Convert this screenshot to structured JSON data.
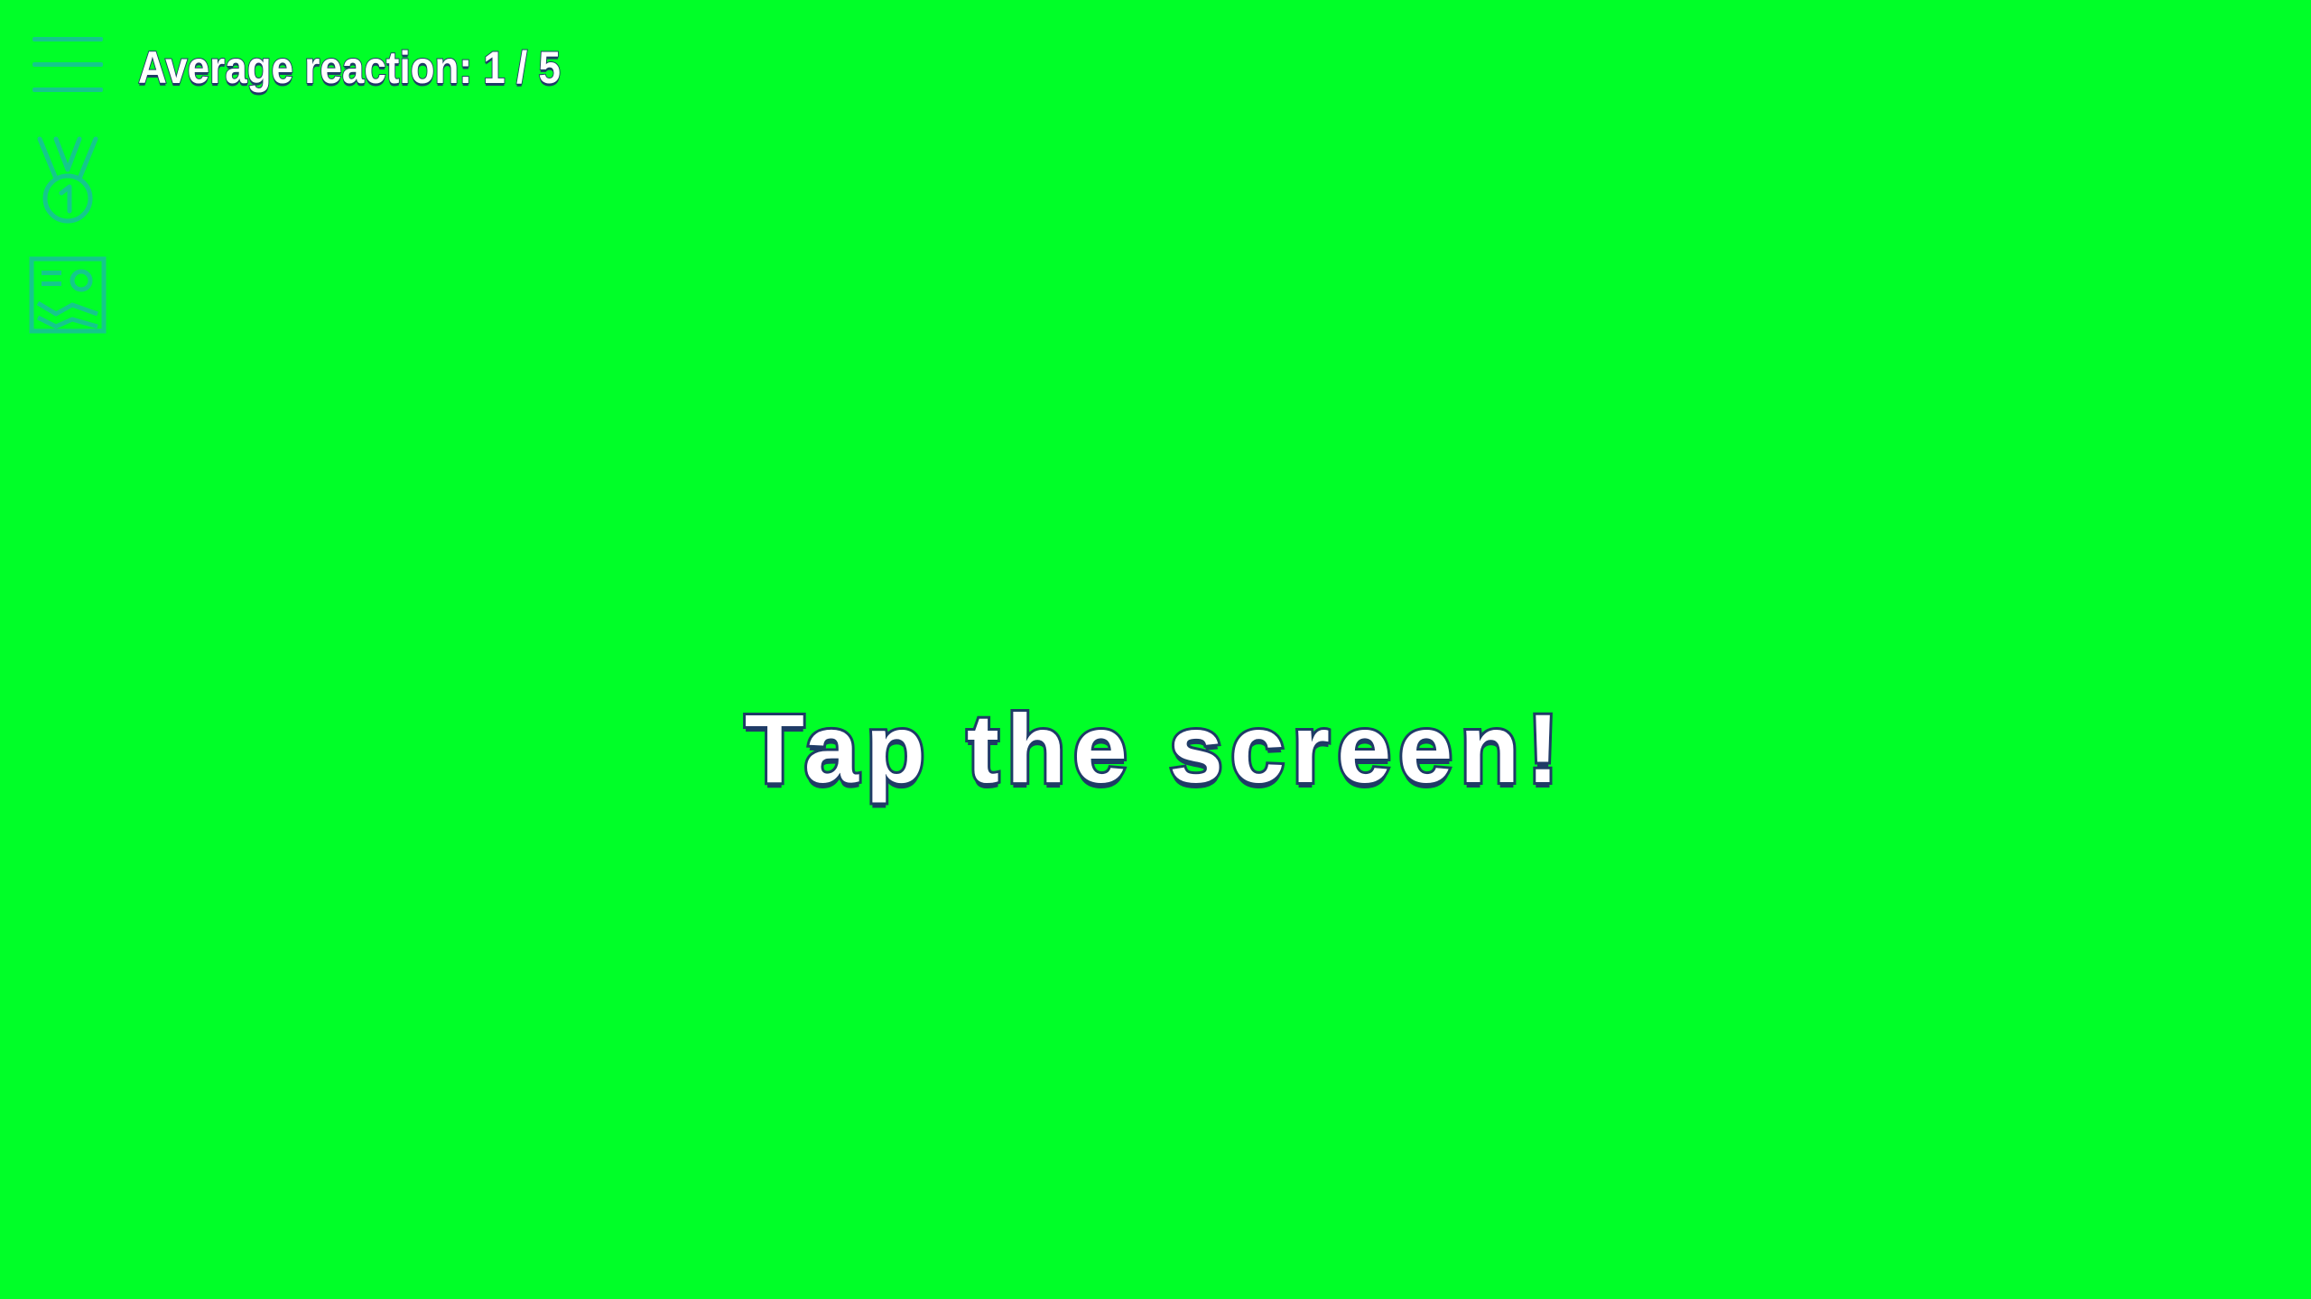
{
  "header": {
    "status_text": "Average reaction: 1 / 5"
  },
  "main": {
    "prompt": "Tap the screen!"
  },
  "sidebar": {
    "icons": [
      "menu-icon",
      "medal-icon",
      "gallery-icon"
    ]
  },
  "colors": {
    "background": "#00ff28",
    "icon": "#14c88c",
    "text_fill": "#ffffff",
    "text_outline": "#1f3b66"
  }
}
